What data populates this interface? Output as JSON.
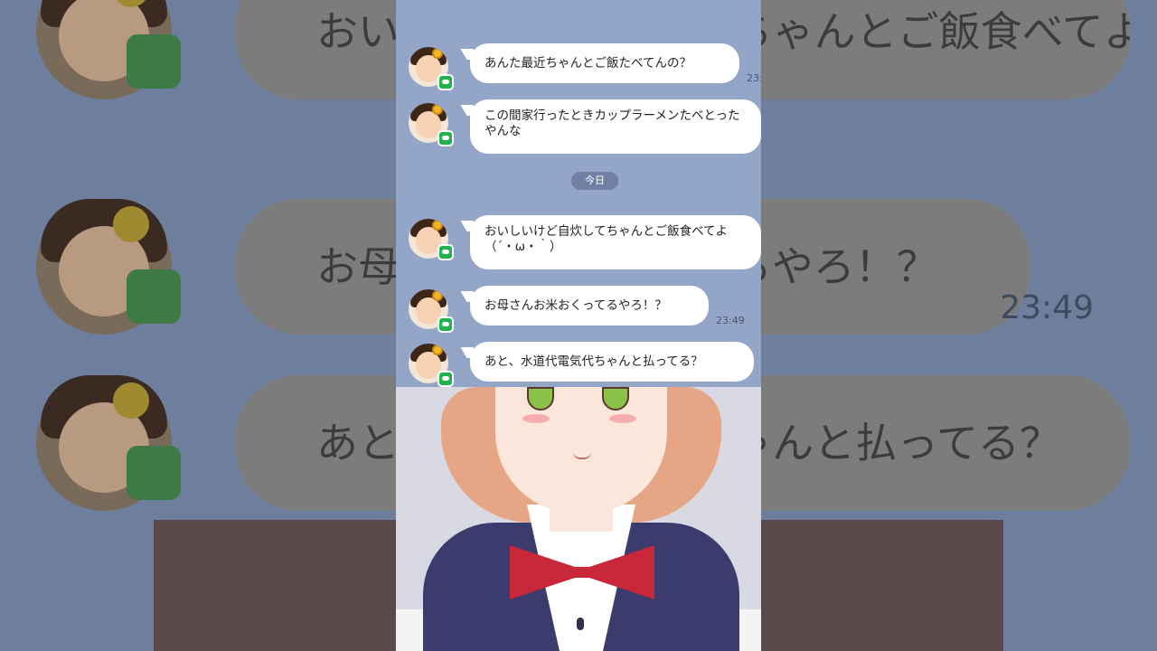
{
  "background": {
    "rows": [
      {
        "text": "おいしいけど自炊してちゃんとご飯食べてよ（´・ω・｀）"
      },
      {
        "text": "お母さんお米おくってるやろ！？",
        "time": "23:49"
      },
      {
        "text": "あと、水道代電気代ちゃんと払ってる？"
      }
    ]
  },
  "chat": {
    "date_separator": "今日",
    "messages": [
      {
        "text": "あんた最近ちゃんとご飯たべてんの？",
        "time": "23:"
      },
      {
        "text": "この間家行ったときカップラーメンたべとったやんな",
        "time": ""
      },
      {
        "text": "おいしいけど自炊してちゃんとご飯食べてよ（´・ω・｀）",
        "time": ""
      },
      {
        "text": "お母さんお米おくってるやろ！？",
        "time": "23:49"
      },
      {
        "text": "あと、水道代電気代ちゃんと払ってる？",
        "time": ""
      }
    ]
  },
  "colors": {
    "chat_background": "#93a6c8",
    "bubble": "#ffffff",
    "line_green": "#21b24b",
    "date_pill": "#6f80a3"
  },
  "icons": [
    "avatar-mother",
    "line-app-icon"
  ]
}
